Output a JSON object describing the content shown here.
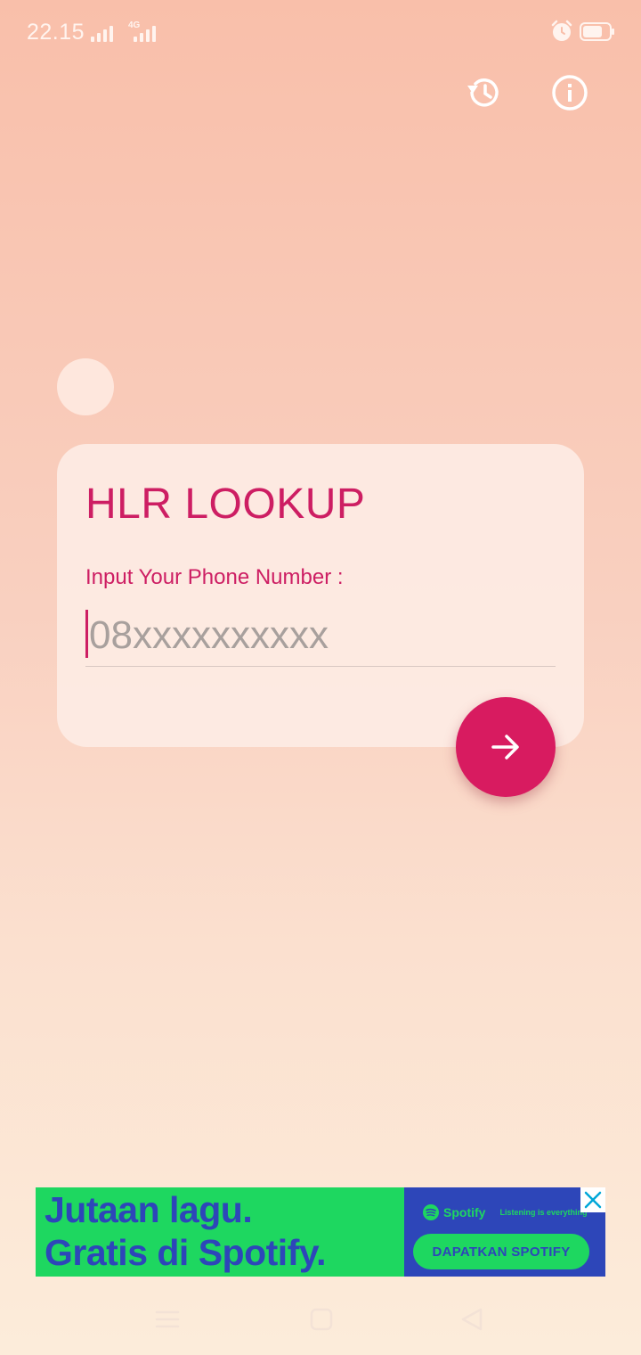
{
  "status_bar": {
    "time": "22.15",
    "network_type": "4G"
  },
  "toolbar": {
    "history_icon": "history-icon",
    "info_icon": "info-icon"
  },
  "card": {
    "title": "HLR LOOKUP",
    "input_label": "Input Your Phone Number :",
    "input_placeholder": "08xxxxxxxxxx",
    "input_value": ""
  },
  "submit": {
    "icon": "arrow-right-icon"
  },
  "ad": {
    "headline_line1": "Jutaan lagu.",
    "headline_line2": "Gratis di Spotify.",
    "brand": "Spotify",
    "tagline": "Listening is everything",
    "cta": "DAPATKAN SPOTIFY"
  },
  "colors": {
    "accent": "#d81b60",
    "title": "#cd1e63",
    "ad_green": "#1ed760",
    "ad_blue": "#2d46b9",
    "background_top": "#f9bfaa",
    "background_bottom": "#fcecda"
  }
}
